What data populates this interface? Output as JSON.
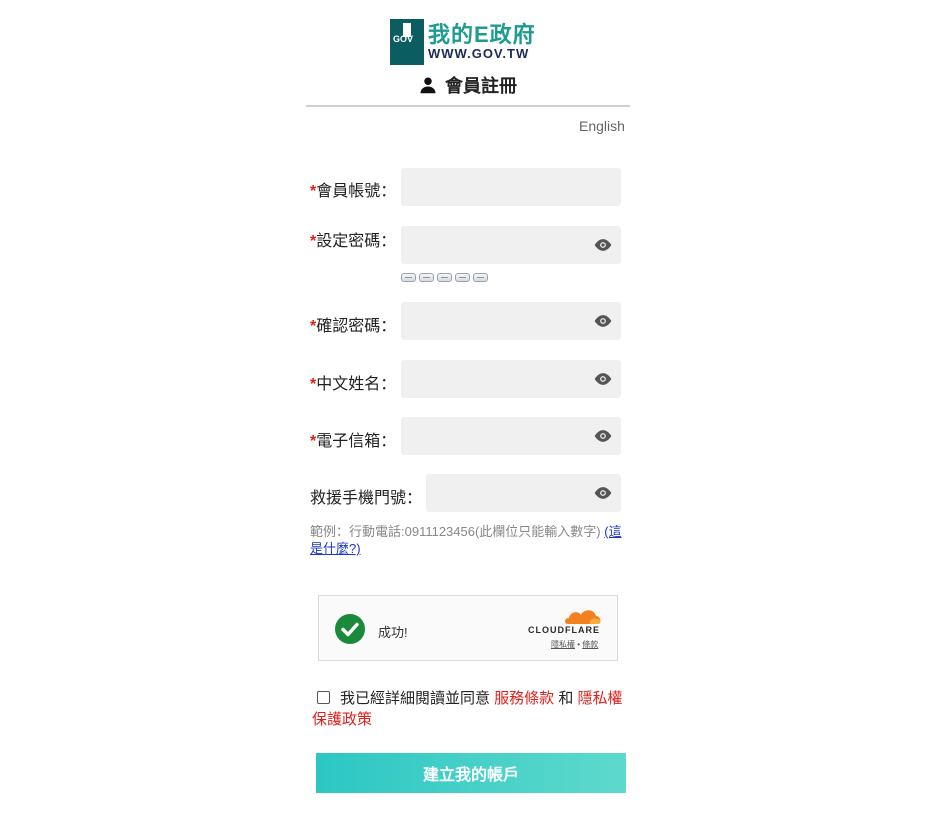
{
  "logo": {
    "badge": "GOV",
    "title": "我的E政府",
    "url": "WWW.GOV.TW"
  },
  "header": {
    "title": "會員註冊",
    "icon": "person-icon"
  },
  "language_link": "English",
  "required_mark": "*",
  "form": {
    "account_label": "會員帳號：",
    "password_label": "設定密碼：",
    "confirm_password_label": "確認密碼：",
    "chinese_name_label": "中文姓名：",
    "email_label": "電子信箱：",
    "rescue_phone_label": "救援手機門號：",
    "account_value": "",
    "password_value": "",
    "confirm_password_value": "",
    "chinese_name_value": "",
    "email_value": "",
    "rescue_phone_value": "",
    "password_strength_segments": 5
  },
  "hint": {
    "text": "範例：行動電話:0911123456(此欄位只能輸入數字) ",
    "link": "(這是什麼?)"
  },
  "captcha": {
    "status": "成功!",
    "brand": "CLOUDFLARE",
    "privacy": "隱私權",
    "separator": " • ",
    "terms": "條款"
  },
  "agreement": {
    "prefix": "我已經詳細閱讀並同意 ",
    "terms_link": "服務條款",
    "and": " 和 ",
    "privacy_link": "隱私權保護政策",
    "checked": false
  },
  "submit_label": "建立我的帳戶",
  "colors": {
    "accent_teal": "#2cc7c3",
    "required_red": "#e0201b",
    "link_blue": "#1a36c8",
    "success_green": "#1a8a3a",
    "cloudflare_orange": "#f48120"
  }
}
